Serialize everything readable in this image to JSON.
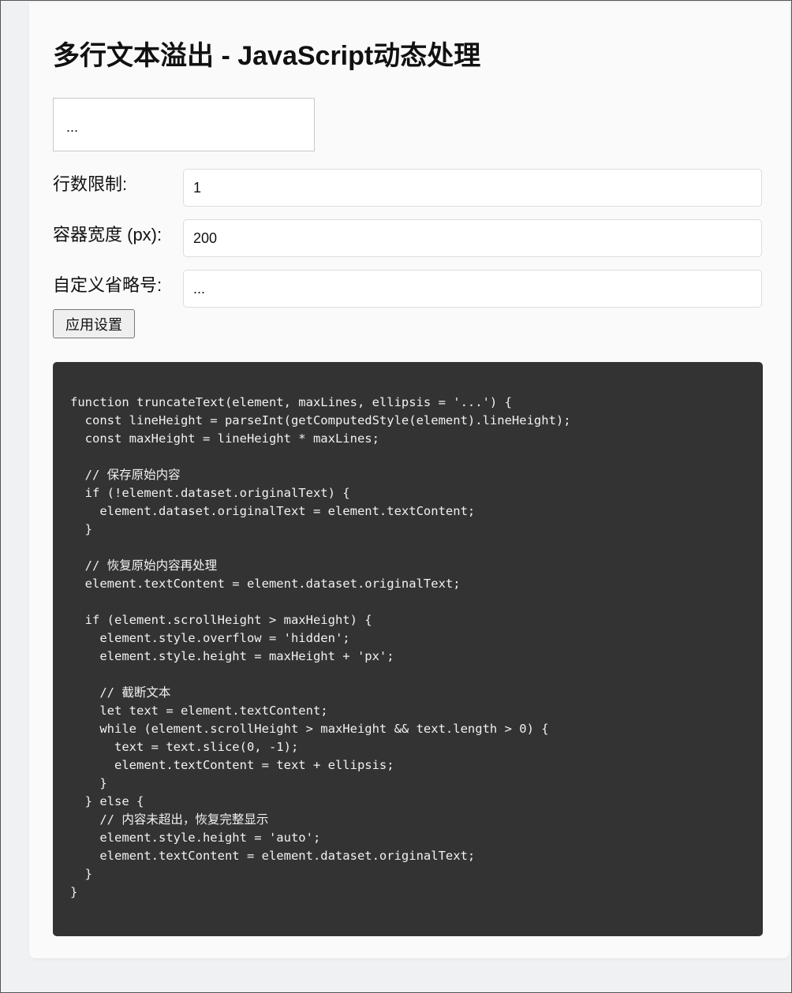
{
  "page": {
    "title": "多行文本溢出 - JavaScript动态处理"
  },
  "demo": {
    "text": "..."
  },
  "controls": {
    "lines_label": "行数限制:",
    "lines_value": "1",
    "width_label": "容器宽度 (px):",
    "width_value": "200",
    "ellipsis_label": "自定义省略号:",
    "ellipsis_value": "...",
    "apply_label": "应用设置"
  },
  "code": {
    "source": "function truncateText(element, maxLines, ellipsis = '...') {\n  const lineHeight = parseInt(getComputedStyle(element).lineHeight);\n  const maxHeight = lineHeight * maxLines;\n\n  // 保存原始内容\n  if (!element.dataset.originalText) {\n    element.dataset.originalText = element.textContent;\n  }\n\n  // 恢复原始内容再处理\n  element.textContent = element.dataset.originalText;\n\n  if (element.scrollHeight > maxHeight) {\n    element.style.overflow = 'hidden';\n    element.style.height = maxHeight + 'px';\n\n    // 截断文本\n    let text = element.textContent;\n    while (element.scrollHeight > maxHeight && text.length > 0) {\n      text = text.slice(0, -1);\n      element.textContent = text + ellipsis;\n    }\n  } else {\n    // 内容未超出，恢复完整显示\n    element.style.height = 'auto';\n    element.textContent = element.dataset.originalText;\n  }\n}"
  }
}
